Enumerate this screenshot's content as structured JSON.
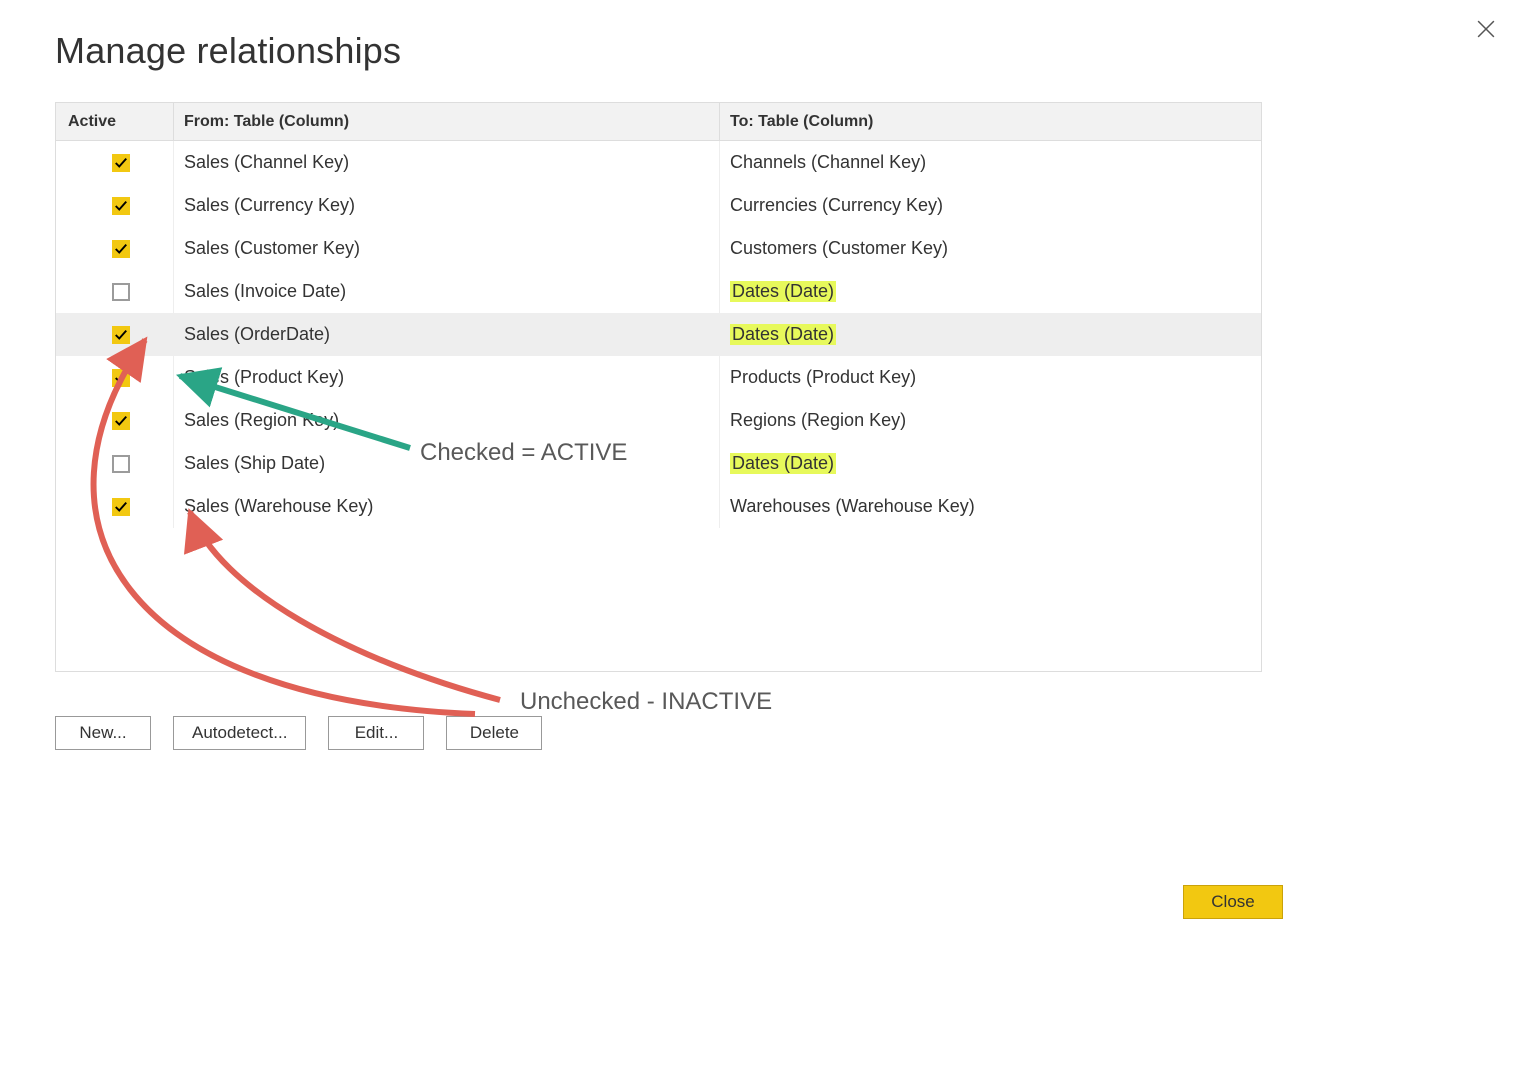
{
  "dialog": {
    "title": "Manage relationships",
    "headers": {
      "active": "Active",
      "from": "From: Table (Column)",
      "to": "To: Table (Column)"
    },
    "rows": [
      {
        "active": true,
        "from": "Sales (Channel Key)",
        "to": "Channels (Channel Key)",
        "to_highlight": false,
        "selected": false
      },
      {
        "active": true,
        "from": "Sales (Currency Key)",
        "to": "Currencies (Currency Key)",
        "to_highlight": false,
        "selected": false
      },
      {
        "active": true,
        "from": "Sales (Customer Key)",
        "to": "Customers (Customer Key)",
        "to_highlight": false,
        "selected": false
      },
      {
        "active": false,
        "from": "Sales (Invoice Date)",
        "to": "Dates (Date)",
        "to_highlight": true,
        "selected": false
      },
      {
        "active": true,
        "from": "Sales (OrderDate)",
        "to": "Dates (Date)",
        "to_highlight": true,
        "selected": true
      },
      {
        "active": true,
        "from": "Sales (Product Key)",
        "to": "Products (Product Key)",
        "to_highlight": false,
        "selected": false
      },
      {
        "active": true,
        "from": "Sales (Region Key)",
        "to": "Regions (Region Key)",
        "to_highlight": false,
        "selected": false
      },
      {
        "active": false,
        "from": "Sales (Ship Date)",
        "to": "Dates (Date)",
        "to_highlight": true,
        "selected": false
      },
      {
        "active": true,
        "from": "Sales (Warehouse Key)",
        "to": "Warehouses (Warehouse Key)",
        "to_highlight": false,
        "selected": false
      }
    ],
    "buttons": {
      "new": "New...",
      "autodetect": "Autodetect...",
      "edit": "Edit...",
      "delete": "Delete",
      "close": "Close"
    }
  },
  "annotations": {
    "active_label": "Checked = ACTIVE",
    "inactive_label": "Unchecked - INACTIVE"
  },
  "colors": {
    "accent": "#f2c811",
    "highlight": "#e7f95b",
    "arrow_green": "#2aa586",
    "arrow_red": "#e06055"
  }
}
